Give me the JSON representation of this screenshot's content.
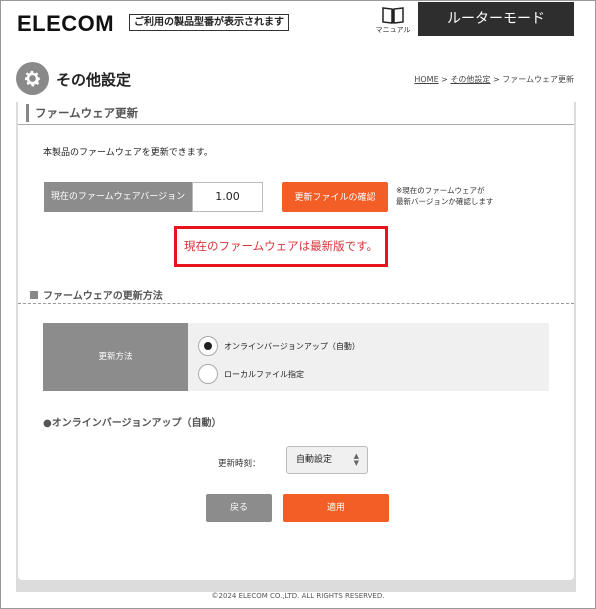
{
  "header": {
    "logo": "ELECOM",
    "tagline": "ご利用の製品型番が表示されます",
    "manual_label": "マニュアル",
    "mode_button": "ルーターモード"
  },
  "page": {
    "title": "その他設定",
    "breadcrumb": {
      "home": "HOME",
      "sep1": " > ",
      "parent": "その他設定",
      "sep2": " > ",
      "current": "ファームウェア更新"
    }
  },
  "section": {
    "title": "ファームウェア更新",
    "description": "本製品のファームウェアを更新できます。",
    "version_label": "現在のファームウェアバージョン",
    "version_value": "1.00",
    "check_button": "更新ファイルの確認",
    "note_line1": "※現在のファームウェアが",
    "note_line2": "最新バージョンか確認します",
    "status_message": "現在のファームウェアは最新版です。"
  },
  "update_method": {
    "heading": "ファームウェアの更新方法",
    "label": "更新方法",
    "options": [
      {
        "label": "オンラインバージョンアップ（自動）",
        "selected": true
      },
      {
        "label": "ローカルファイル指定",
        "selected": false
      }
    ]
  },
  "online": {
    "heading": "●オンラインバージョンアップ（自動）",
    "time_label": "更新時刻：",
    "time_value": "自動設定"
  },
  "buttons": {
    "back": "戻る",
    "apply": "適用"
  },
  "footer": {
    "copyright": "©2024 ELECOM CO.,LTD. ALL RIGHTS RESERVED."
  },
  "colors": {
    "accent": "#f35e27",
    "status_border": "#e8141b",
    "label_gray": "#8c8c8c",
    "header_dark": "#2e2e2e"
  },
  "icons": {
    "manual": "book-icon",
    "settings": "gear-icon",
    "select_arrows": "updown-arrow-icon",
    "radio": "radio-icon"
  }
}
